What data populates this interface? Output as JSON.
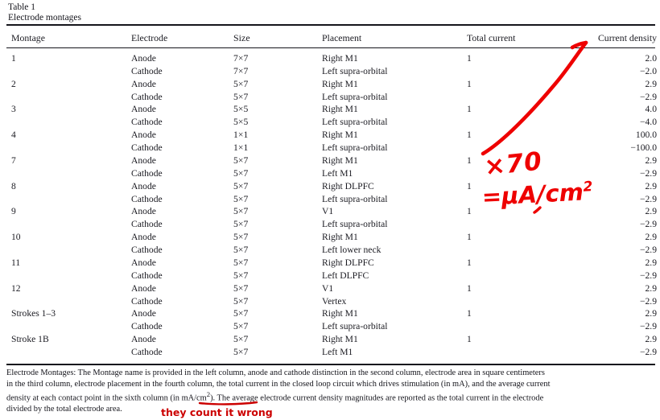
{
  "caption": {
    "line1": "Table 1",
    "line2": "Electrode montages"
  },
  "table": {
    "headers": {
      "montage": "Montage",
      "electrode": "Electrode",
      "size": "Size",
      "placement": "Placement",
      "total_current": "Total current",
      "current_density": "Current density"
    },
    "rows": [
      {
        "montage": "1",
        "electrode": "Anode",
        "size": "7×7",
        "placement": "Right M1",
        "total_current": "1",
        "current_density": "2.0"
      },
      {
        "montage": "",
        "electrode": "Cathode",
        "size": "7×7",
        "placement": "Left supra-orbital",
        "total_current": "",
        "current_density": "−2.0"
      },
      {
        "montage": "2",
        "electrode": "Anode",
        "size": "5×7",
        "placement": "Right M1",
        "total_current": "1",
        "current_density": "2.9"
      },
      {
        "montage": "",
        "electrode": "Cathode",
        "size": "5×7",
        "placement": "Left supra-orbital",
        "total_current": "",
        "current_density": "−2.9"
      },
      {
        "montage": "3",
        "electrode": "Anode",
        "size": "5×5",
        "placement": "Right M1",
        "total_current": "1",
        "current_density": "4.0"
      },
      {
        "montage": "",
        "electrode": "Cathode",
        "size": "5×5",
        "placement": "Left supra-orbital",
        "total_current": "",
        "current_density": "−4.0"
      },
      {
        "montage": "4",
        "electrode": "Anode",
        "size": "1×1",
        "placement": "Right M1",
        "total_current": "1",
        "current_density": "100.0"
      },
      {
        "montage": "",
        "electrode": "Cathode",
        "size": "1×1",
        "placement": "Left supra-orbital",
        "total_current": "",
        "current_density": "−100.0"
      },
      {
        "montage": "7",
        "electrode": "Anode",
        "size": "5×7",
        "placement": "Right M1",
        "total_current": "1",
        "current_density": "2.9"
      },
      {
        "montage": "",
        "electrode": "Cathode",
        "size": "5×7",
        "placement": "Left M1",
        "total_current": "",
        "current_density": "−2.9"
      },
      {
        "montage": "8",
        "electrode": "Anode",
        "size": "5×7",
        "placement": "Right DLPFC",
        "total_current": "1",
        "current_density": "2.9"
      },
      {
        "montage": "",
        "electrode": "Cathode",
        "size": "5×7",
        "placement": "Left supra-orbital",
        "total_current": "",
        "current_density": "−2.9"
      },
      {
        "montage": "9",
        "electrode": "Anode",
        "size": "5×7",
        "placement": "V1",
        "total_current": "1",
        "current_density": "2.9"
      },
      {
        "montage": "",
        "electrode": "Cathode",
        "size": "5×7",
        "placement": "Left supra-orbital",
        "total_current": "",
        "current_density": "−2.9"
      },
      {
        "montage": "10",
        "electrode": "Anode",
        "size": "5×7",
        "placement": "Right M1",
        "total_current": "1",
        "current_density": "2.9"
      },
      {
        "montage": "",
        "electrode": "Cathode",
        "size": "5×7",
        "placement": "Left lower neck",
        "total_current": "",
        "current_density": "−2.9"
      },
      {
        "montage": "11",
        "electrode": "Anode",
        "size": "5×7",
        "placement": "Right DLPFC",
        "total_current": "1",
        "current_density": "2.9"
      },
      {
        "montage": "",
        "electrode": "Cathode",
        "size": "5×7",
        "placement": "Left DLPFC",
        "total_current": "",
        "current_density": "−2.9"
      },
      {
        "montage": "12",
        "electrode": "Anode",
        "size": "5×7",
        "placement": "V1",
        "total_current": "1",
        "current_density": "2.9"
      },
      {
        "montage": "",
        "electrode": "Cathode",
        "size": "5×7",
        "placement": "Vertex",
        "total_current": "",
        "current_density": "−2.9"
      },
      {
        "montage": "Strokes 1–3",
        "electrode": "Anode",
        "size": "5×7",
        "placement": "Right M1",
        "total_current": "1",
        "current_density": "2.9"
      },
      {
        "montage": "",
        "electrode": "Cathode",
        "size": "5×7",
        "placement": "Left supra-orbital",
        "total_current": "",
        "current_density": "−2.9"
      },
      {
        "montage": "Stroke 1B",
        "electrode": "Anode",
        "size": "5×7",
        "placement": "Right M1",
        "total_current": "1",
        "current_density": "2.9"
      },
      {
        "montage": "",
        "electrode": "Cathode",
        "size": "5×7",
        "placement": "Left M1",
        "total_current": "",
        "current_density": "−2.9"
      }
    ]
  },
  "footnote": {
    "line1": "Electrode Montages: The Montage name is provided in the left column, anode and cathode distinction in the second column, electrode area in square centimeters",
    "line2": "in the third column, electrode placement in the fourth column, the total current in the closed loop circuit which drives stimulation (in mA), and the average current",
    "line3a": "density at each contact point in the sixth column (",
    "line3b": "in mA/cm",
    "line3c": "2",
    "line3d": "). The average electrode current density magnitudes are reported as the total current in the electrode",
    "line4": "divided by the total electrode area."
  },
  "annotations": {
    "multiplier": "×70",
    "unit_main": "=μA/cm",
    "unit_exp": "2",
    "note": "they count it wrong",
    "ink_color": "#ee0000"
  }
}
